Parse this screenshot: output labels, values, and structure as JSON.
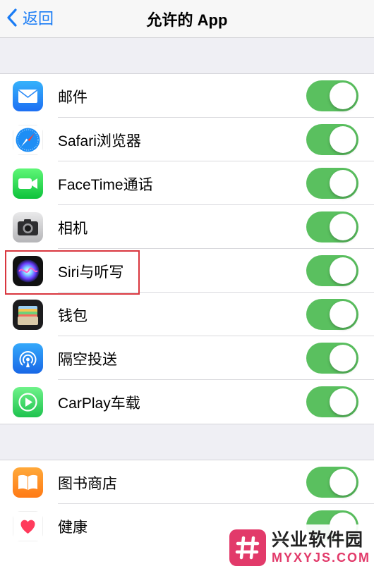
{
  "nav": {
    "back_label": "返回",
    "title": "允许的 App"
  },
  "groups": [
    {
      "items": [
        {
          "label": "邮件",
          "icon": "mail-icon",
          "enabled": true
        },
        {
          "label": "Safari浏览器",
          "icon": "safari-icon",
          "enabled": true
        },
        {
          "label": "FaceTime通话",
          "icon": "facetime-icon",
          "enabled": true
        },
        {
          "label": "相机",
          "icon": "camera-icon",
          "enabled": true
        },
        {
          "label": "Siri与听写",
          "icon": "siri-icon",
          "enabled": true
        },
        {
          "label": "钱包",
          "icon": "wallet-icon",
          "enabled": true
        },
        {
          "label": "隔空投送",
          "icon": "airdrop-icon",
          "enabled": true
        },
        {
          "label": "CarPlay车载",
          "icon": "carplay-icon",
          "enabled": true
        }
      ]
    },
    {
      "items": [
        {
          "label": "图书商店",
          "icon": "books-icon",
          "enabled": true
        },
        {
          "label": "健康",
          "icon": "health-icon",
          "enabled": true
        }
      ]
    }
  ],
  "watermark": {
    "name": "兴业软件园",
    "domain": "MYXYJS.COM"
  },
  "colors": {
    "accent": "#1a7cf5",
    "toggle_on": "#5ac05f",
    "highlight": "#d9363e"
  }
}
